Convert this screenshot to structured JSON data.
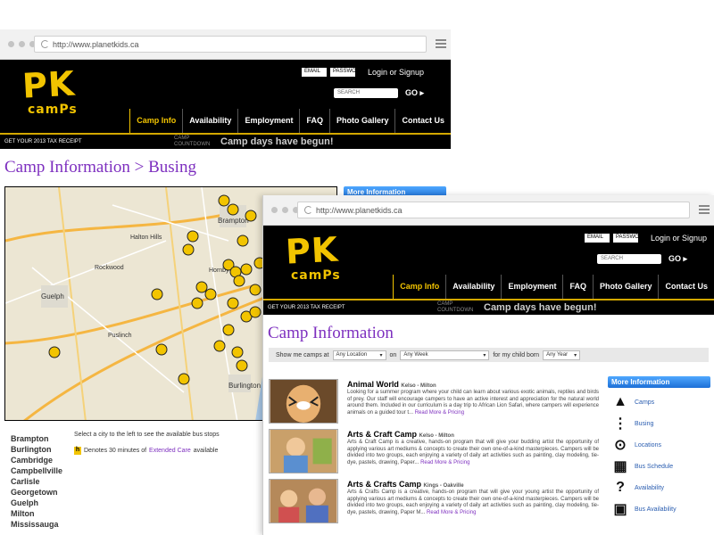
{
  "window1": {
    "url": "http://www.planetkids.ca",
    "page_title": "Camp Information > Busing",
    "more_info": "More Information",
    "city_hint": "Select a city to the left to see the available bus stops",
    "extended_care_prefix": "Denotes 30 minutes of",
    "extended_care_link": "Extended Care",
    "extended_care_suffix": "available",
    "cities": [
      "Brampton",
      "Burlington",
      "Cambridge",
      "Campbellville",
      "Carlisle",
      "Georgetown",
      "Guelph",
      "Milton",
      "Mississauga"
    ],
    "map_labels": [
      "Brampton",
      "Halton Hills",
      "Rockwood",
      "Guelph",
      "Puslinch",
      "Burlington",
      "Hornby"
    ]
  },
  "header": {
    "logo_pk": "PK",
    "logo_camps": "camPs",
    "email_placeholder": "EMAIL",
    "password_placeholder": "PASSWO",
    "login": "Login or Signup",
    "search_placeholder": "SEARCH",
    "go": "GO ▸",
    "nav": [
      "Camp Info",
      "Availability",
      "Employment",
      "FAQ",
      "Photo Gallery",
      "Contact Us"
    ],
    "tax_receipt": "GET YOUR 2013 TAX RECEIPT",
    "camp_countdown": "CAMP COUNTDOWN",
    "banner": "Camp days have begun!"
  },
  "window2": {
    "url": "http://www.planetkids.ca",
    "page_title": "Camp Information",
    "filter": {
      "show_me": "Show me camps at",
      "location": "Any Location",
      "on": "on",
      "week": "Any Week",
      "for_child": "for my child born",
      "year": "Any Year"
    },
    "camps": [
      {
        "name": "Animal World",
        "location": "Kelso - Milton",
        "desc": "Looking for a summer program where your child can learn about various exotic animals, reptiles and birds of prey. Our staff will encourage campers to have an active interest and appreciation for the natural world around them. Included in our curriculum is a day trip to African Lion Safari, where campers will experience animals on a guided tour t...",
        "read_more": "Read More & Pricing"
      },
      {
        "name": "Arts & Craft Camp",
        "location": "Kelso - Milton",
        "desc": "Arts & Craft Camp is a creative, hands-on program that will give your budding artist the opportunity of applying various art mediums & concepts to create their own one-of-a-kind masterpieces. Campers will be divided into two groups, each enjoying a variety of daily art activities such as painting, clay modeling, tie-dye, pastels, drawing, Paper...",
        "read_more": "Read More & Pricing"
      },
      {
        "name": "Arts & Crafts Camp",
        "location": "Kings - Oakville",
        "desc": "Arts & Crafts Camp is a creative, hands-on program that will give your young artist the opportunity of applying various art mediums & concepts to create their own one-of-a-kind masterpieces. Campers will be divided into two groups, each enjoying a variety of daily art activities such as painting, clay modeling, tie-dye, pastels, drawing, Paper M...",
        "read_more": "Read More & Pricing"
      }
    ],
    "more_info": "More Information",
    "sidebar": [
      {
        "label": "Camps",
        "icon": "tent-icon"
      },
      {
        "label": "Busing",
        "icon": "road-icon"
      },
      {
        "label": "Locations",
        "icon": "map-pin-icon"
      },
      {
        "label": "Bus Schedule",
        "icon": "calendar-icon"
      },
      {
        "label": "Availability",
        "icon": "question-icon"
      },
      {
        "label": "Bus Availability",
        "icon": "bus-icon"
      }
    ]
  },
  "colors": {
    "brand_yellow": "#f2c400",
    "title_purple": "#7d2fbf",
    "link_blue": "#2a5db0"
  }
}
